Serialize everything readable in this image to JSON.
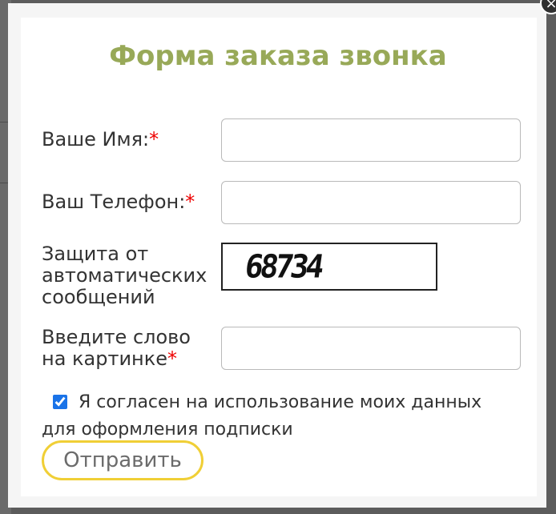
{
  "form": {
    "title": "Форма заказа звонка",
    "name_label": "Ваше Имя:",
    "phone_label": "Ваш Телефон:",
    "captcha_label": "Защита от автоматических сообщений",
    "captcha_label_lines": [
      "Защита от",
      "автоматических",
      "сообщений"
    ],
    "captcha_code": "68734",
    "captcha_input_label_lines": [
      "Введите слово",
      "на картинке"
    ],
    "required_mark": "*",
    "name_value": "",
    "phone_value": "",
    "captcha_value": "",
    "consent_checked": true,
    "consent_text": "Я согласен на использование моих данных для оформления подписки",
    "submit_label": "Отправить"
  },
  "close_icon": "close-icon",
  "colors": {
    "title": "#98a958",
    "required": "#e00000",
    "submit_border": "#f0cf36",
    "overlay": "#5c5c5c"
  }
}
